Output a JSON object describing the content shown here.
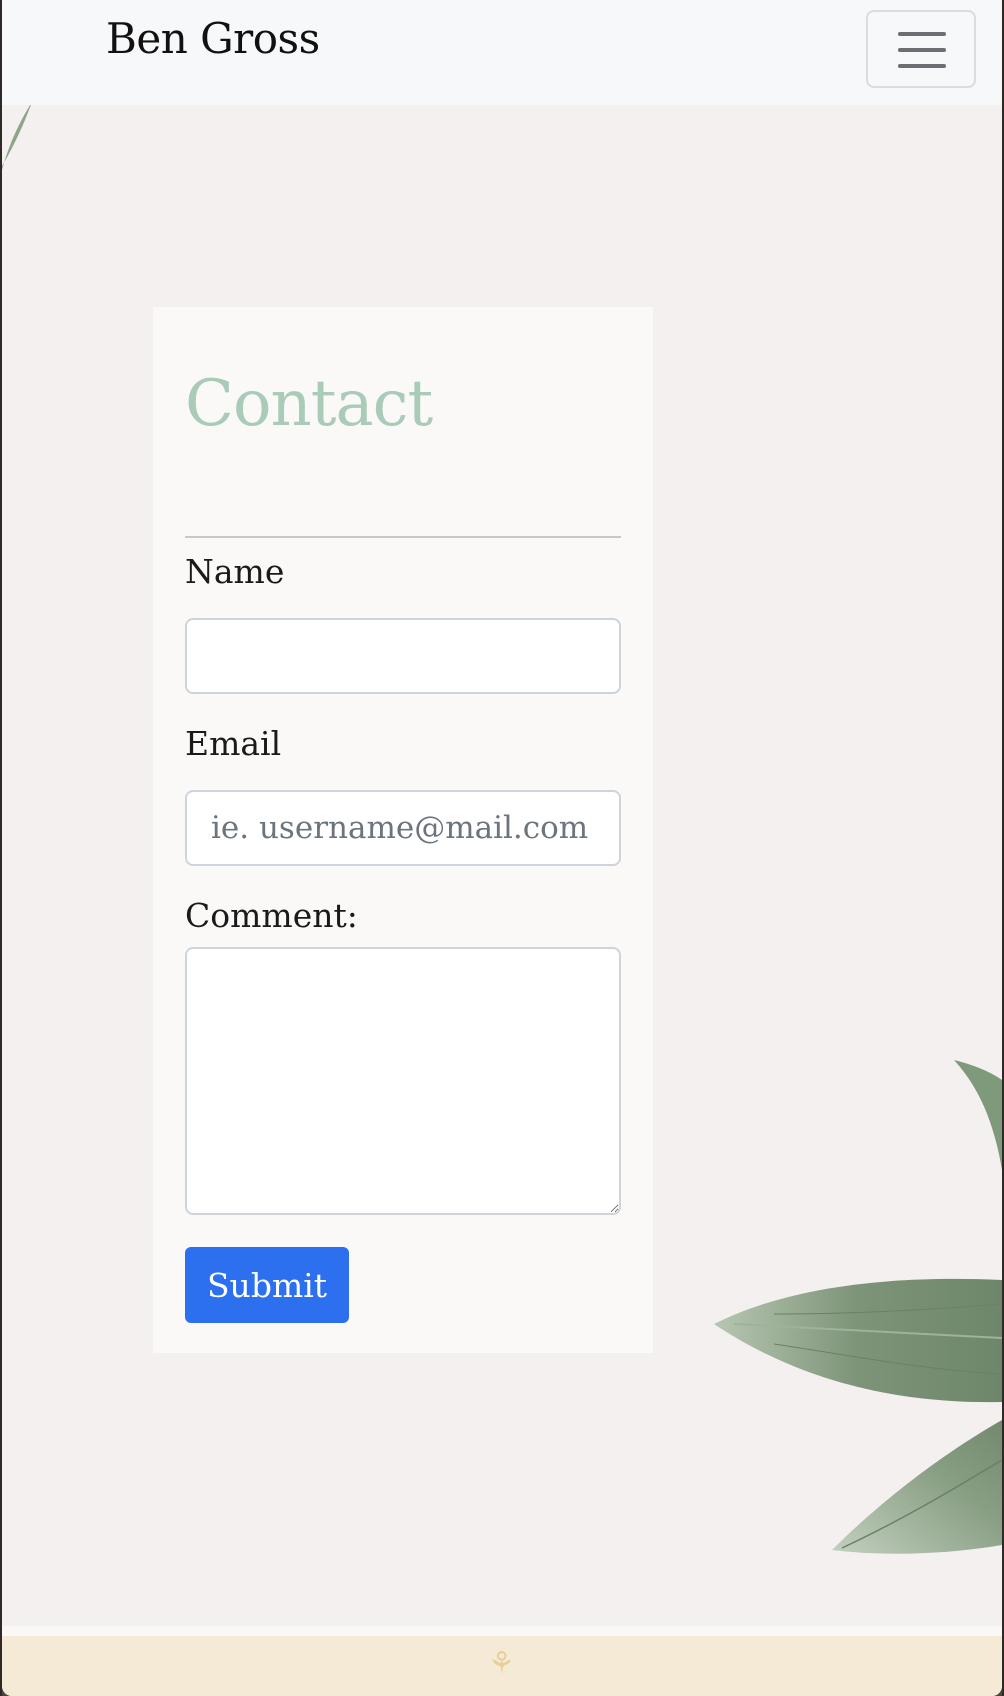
{
  "navbar": {
    "brand": "Ben Gross",
    "toggler_icon": "hamburger-menu-icon"
  },
  "contact": {
    "title": "Contact",
    "name_label": "Name",
    "name_value": "",
    "email_label": "Email",
    "email_placeholder": "ie. username@mail.com",
    "comment_label": "Comment:",
    "comment_value": "",
    "submit_label": "Submit"
  },
  "footer": {
    "icon": "leaf-sprig-icon"
  },
  "colors": {
    "heading": "#a9cbb8",
    "submit": "#2c6fef",
    "page_bg": "#f3f0ef",
    "card_bg": "#faf9f8",
    "footer_bg": "#f5ead6",
    "leaf": "#7d9478"
  }
}
